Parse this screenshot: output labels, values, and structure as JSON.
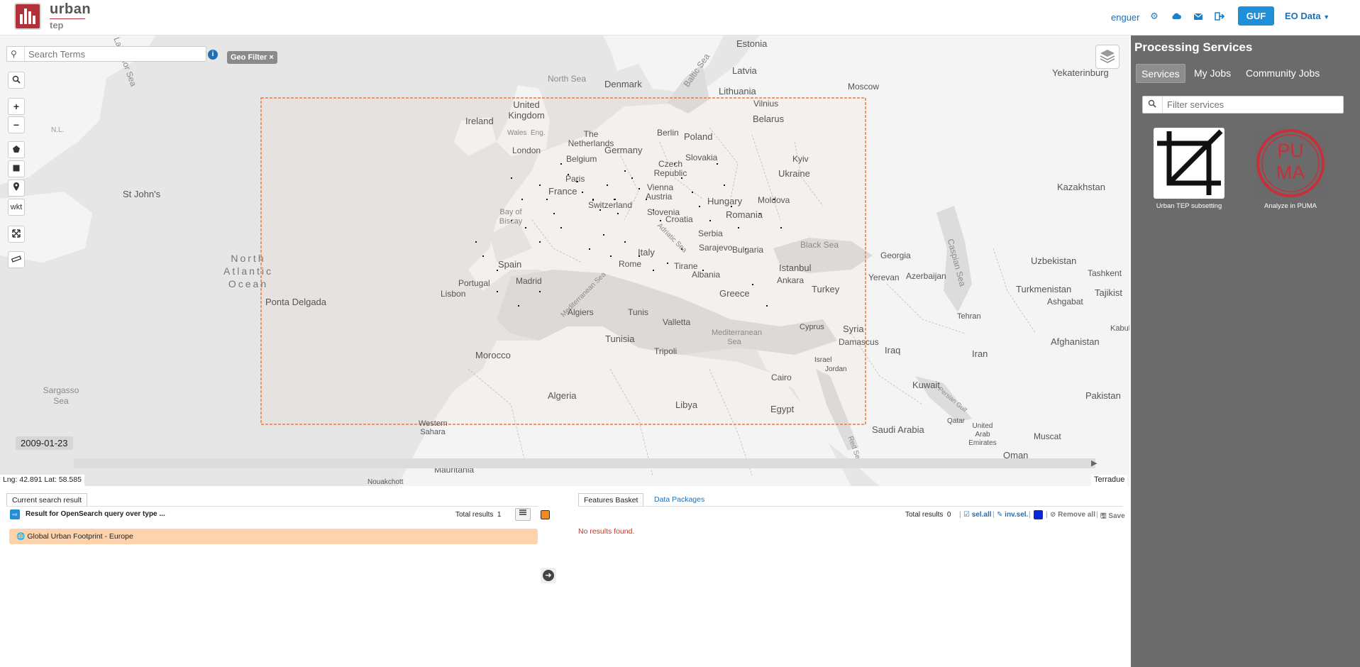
{
  "header": {
    "logo_word1": "urban",
    "logo_word2": "tep",
    "username": "enguer",
    "guf_label": "GUF",
    "eo_data_label": "EO Data",
    "icons": [
      "gear-icon",
      "cloud-icon",
      "envelope-icon",
      "sign-out-icon"
    ]
  },
  "map": {
    "search_placeholder": "Search Terms",
    "geo_filter_label": "Geo Filter ×",
    "controls": {
      "search": "⌕",
      "zoom_in": "+",
      "zoom_out": "−",
      "wkt": "wkt"
    },
    "date": "2009-01-23",
    "coords": "Lng: 42.891 Lat: 58.585",
    "attribution": "Terradue",
    "labels": {
      "estonia": "Estonia",
      "latvia": "Latvia",
      "lithuania": "Lithuania",
      "vilnius": "Vilnius",
      "moscow": "Moscow",
      "yekaterinburg": "Yekaterinburg",
      "north_sea": "North Sea",
      "denmark": "Denmark",
      "baltic_sea": "Baltic Sea",
      "united_kingdom": "United Kingdom",
      "ireland": "Ireland",
      "wales": "Wales",
      "eng": "Eng.",
      "london": "London",
      "the_netherlands": "The Netherlands",
      "belgium": "Belgium",
      "berlin": "Berlin",
      "poland": "Poland",
      "belarus": "Belarus",
      "germany": "Germany",
      "czech": "Czech Republic",
      "slovakia": "Slovakia",
      "paris": "Paris",
      "vienna": "Vienna",
      "austria": "Austria",
      "kyiv": "Kyiv",
      "ukraine": "Ukraine",
      "kazakhstan": "Kazakhstan",
      "france": "France",
      "switzerland": "Switzerland",
      "hungary": "Hungary",
      "moldova": "Moldova",
      "slovenia": "Slovenia",
      "croatia": "Croatia",
      "romania": "Romania",
      "bay_of_biscay": "Bay of Biscay",
      "serbia": "Serbia",
      "st_johns": "St John's",
      "sarajevo": "Sarajevo",
      "bulgaria": "Bulgaria",
      "black_sea": "Black Sea",
      "italy": "Italy",
      "rome": "Rome",
      "adriatic_sea": "Adriatic Sea",
      "spain": "Spain",
      "madrid": "Madrid",
      "portugal": "Portugal",
      "lisbon": "Lisbon",
      "tirane": "Tirane",
      "albania": "Albania",
      "istanbul": "Istanbul",
      "ankara": "Ankara",
      "turkey": "Turkey",
      "georgia": "Georgia",
      "yerevan": "Yerevan",
      "azerbaijan": "Azerbaijan",
      "caspian_sea": "Caspian Sea",
      "uzbekistan": "Uzbekistan",
      "tashkent": "Tashkent",
      "turkmenistan": "Turkmenistan",
      "ashgabat": "Ashgabat",
      "tajikistan": "Tajikist",
      "ocean": "North Atlantic Ocean",
      "ponta_delgada": "Ponta Delgada",
      "greece": "Greece",
      "mediterranean_sea": "Mediterranean Sea",
      "algiers": "Algiers",
      "tunis": "Tunis",
      "valletta": "Valletta",
      "syria": "Syria",
      "cyprus": "Cyprus",
      "damascus": "Damascus",
      "tehran": "Tehran",
      "iraq": "Iraq",
      "iran": "Iran",
      "afghanistan": "Afghanistan",
      "kabul": "Kabul",
      "tunisia": "Tunisia",
      "tripoli": "Tripoli",
      "mediterranean_sea2": "Mediterranean Sea",
      "morocco": "Morocco",
      "israel": "Israel",
      "jordan": "Jordan",
      "kuwait": "Kuwait",
      "persian_gulf": "Persian Gulf",
      "pakistan": "Pakistan",
      "sargasso_sea": "Sargasso Sea",
      "algeria": "Algeria",
      "libya": "Libya",
      "cairo": "Cairo",
      "egypt": "Egypt",
      "saudi_arabia": "Saudi Arabia",
      "qatar": "Qatar",
      "uae": "United Arab Emirates",
      "muscat": "Muscat",
      "oman": "Oman",
      "western_sahara": "Western Sahara",
      "mauritania": "Mauritania",
      "nouakchott": "Nouakchott",
      "red_sea": "Red Sea",
      "labrador_sea": "Labrador Sea",
      "nl": "N.L.",
      "bergen_nl": "Nl"
    }
  },
  "right_panel": {
    "title": "Processing Services",
    "tabs": [
      "Services",
      "My Jobs",
      "Community Jobs"
    ],
    "active_tab": "Services",
    "filter_placeholder": "Filter services",
    "services": [
      {
        "name": "Urban TEP subsetting",
        "icon": "crop-icon"
      },
      {
        "name": "Analyze in PUMA",
        "icon": "puma-logo",
        "logo_text": "PU MA"
      }
    ]
  },
  "bottom": {
    "left_tab": "Current search result",
    "result_title": "Result for OpenSearch query over type ...",
    "total_results_label": "Total results",
    "total_results_left": "1",
    "result_item": "Global Urban Footprint - Europe",
    "right_tabs": [
      "Features Basket",
      "Data Packages"
    ],
    "total_results_right": "0",
    "sel_all": "sel.all",
    "inv_sel": "inv.sel.",
    "remove_all": "Remove all",
    "save": "Save",
    "no_results": "No results found.",
    "colors": {
      "left_layer": "#f08a24",
      "right_layer": "#0a24d8"
    }
  }
}
